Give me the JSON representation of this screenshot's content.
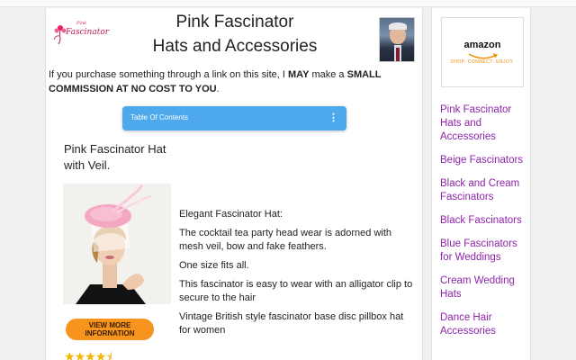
{
  "header": {
    "logo_small": "Pink",
    "logo_text": "Fascinator",
    "title_line1": "Pink Fascinator",
    "title_line2": "Hats and Accessories"
  },
  "disclaimer": {
    "part1": "If you purchase something through a link on this site, I ",
    "emph1": "MAY",
    "part2": " make a ",
    "emph2": "SMALL COMMISSION AT NO COST TO YOU",
    "part3": "."
  },
  "toc": {
    "label": "Table Of Contents",
    "menu_icon": "kebab-menu-icon"
  },
  "product": {
    "title": "Pink Fascinator Hat with Veil.",
    "cta_line1": "VIEW MORE",
    "cta_line2": "INFORNATION",
    "rating_stars": 4.5,
    "description": [
      "Elegant Fascinator Hat:",
      "The cocktail tea party head wear is adorned with mesh veil, bow and fake feathers.",
      "One size fits all.",
      "This fascinator is easy to wear with an alligator clip to secure to the hair",
      "Vintage British style fascinator base disc pillbox hat for women"
    ]
  },
  "sidebar": {
    "amazon": {
      "word": "amazon",
      "tagline": "SHOP. CONNECT. ENJOY."
    },
    "links": [
      "Pink Fascinator Hats and Accessories",
      "Beige Fascinators",
      "Black and Cream Fascinators",
      "Black Fascinators",
      "Blue Fascinators for Weddings",
      "Cream Wedding Hats",
      "Dance Hair Accessories"
    ]
  },
  "colors": {
    "link": "#8e24aa",
    "toc": "#4ea9ec",
    "cta": "#f7941d",
    "brand": "#c2185b"
  }
}
